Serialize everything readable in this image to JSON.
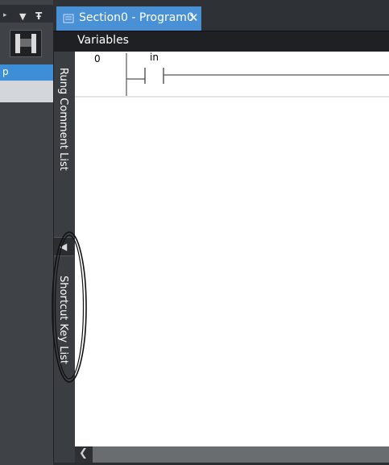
{
  "left_pane": {
    "selected_row_text": "p",
    "toolbar_icon": "ladder-icon",
    "dropdown_icon": "chevron-down-icon",
    "pin_icon": "pin-icon"
  },
  "tab": {
    "title": "Section0 - Program0",
    "close_glyph": "✕",
    "icon": "ladder-program-icon"
  },
  "variables_header": {
    "title": "Variables"
  },
  "side_strip": {
    "rung_comment_list": "Rung Comment List",
    "shortcut_key_list": "Shortcut Key List",
    "collapse_glyph": "◀"
  },
  "ladder": {
    "rung_number": "0",
    "contact_variable": "in"
  },
  "scrollbar": {
    "left_glyph": "❮"
  },
  "colors": {
    "tab_active": "#4a90d4",
    "selected_row": "#3d8ed6",
    "dark_chrome": "#2e3135"
  }
}
